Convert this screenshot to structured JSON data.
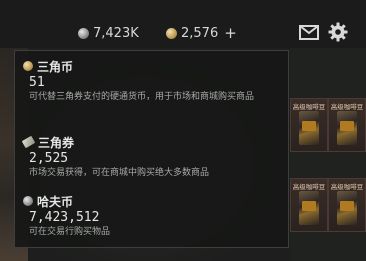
{
  "topbar": {
    "hafu_amount": "7,423K",
    "sanjiao_amount": "2,576",
    "plus_label": "+",
    "icons": [
      "silver-coin-icon",
      "gold-coin-icon",
      "mail-icon",
      "gear-icon"
    ]
  },
  "shop": {
    "card_title": "高级咖啡豆"
  },
  "tooltip": {
    "entries": [
      {
        "name": "三角币",
        "value": "51",
        "desc": "可代替三角券支付的硬通货币，用于市场和商城购买商品",
        "icon": "gold-coin-icon"
      },
      {
        "name": "三角券",
        "value": "2,525",
        "desc": "市场交易获得，可在商城中购买绝大多数商品",
        "icon": "ticket-icon"
      },
      {
        "name": "哈夫币",
        "value": "7,423,512",
        "desc": "可在交易行购买物品",
        "icon": "silver-coin-icon"
      }
    ]
  },
  "colors": {
    "panel_bg": "#161716",
    "text_primary": "#e4e7e4",
    "text_secondary": "#a7aba7",
    "card_title": "#e0c9b0"
  }
}
